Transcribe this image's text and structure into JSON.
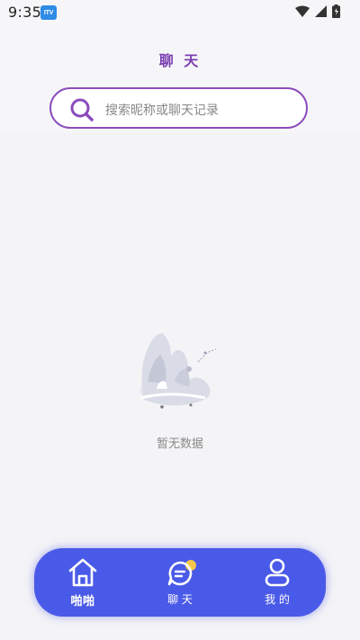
{
  "status_bar": {
    "time": "9:35",
    "badge": "ITV",
    "icons": [
      "wifi-icon",
      "signal-icon",
      "battery-icon"
    ]
  },
  "header": {
    "title": "聊 天"
  },
  "search": {
    "placeholder": "搜索昵称或聊天记录"
  },
  "empty_state": {
    "message": "暂无数据"
  },
  "tab_bar": {
    "tabs": [
      {
        "label": "啪啪",
        "icon": "home-icon",
        "active": true
      },
      {
        "label": "聊 天",
        "icon": "chat-bubble-icon",
        "active": false
      },
      {
        "label": "我 的",
        "icon": "profile-icon",
        "active": false
      }
    ]
  },
  "colors": {
    "accent": "#7b3fb0",
    "tab_bar": "#4a5ae8",
    "background": "#f4f4f6"
  }
}
